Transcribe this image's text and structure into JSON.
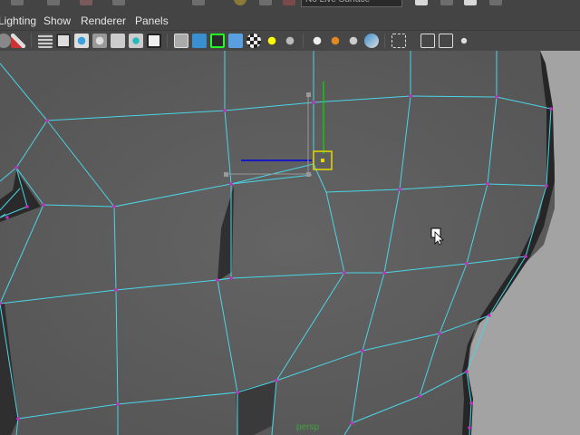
{
  "menu": {
    "items": [
      {
        "label": "Lighting"
      },
      {
        "label": "Show"
      },
      {
        "label": "Renderer"
      },
      {
        "label": "Panels"
      }
    ]
  },
  "status_line": {
    "live_surface": "No Live Surface"
  },
  "viewport": {
    "camera": "persp"
  },
  "colors": {
    "mesh_face": "#5d5d5d",
    "wire": "#49d5e6",
    "vertex": "#c42cc4",
    "manipulator": "#e6d800",
    "background": "#a0a0a0"
  }
}
